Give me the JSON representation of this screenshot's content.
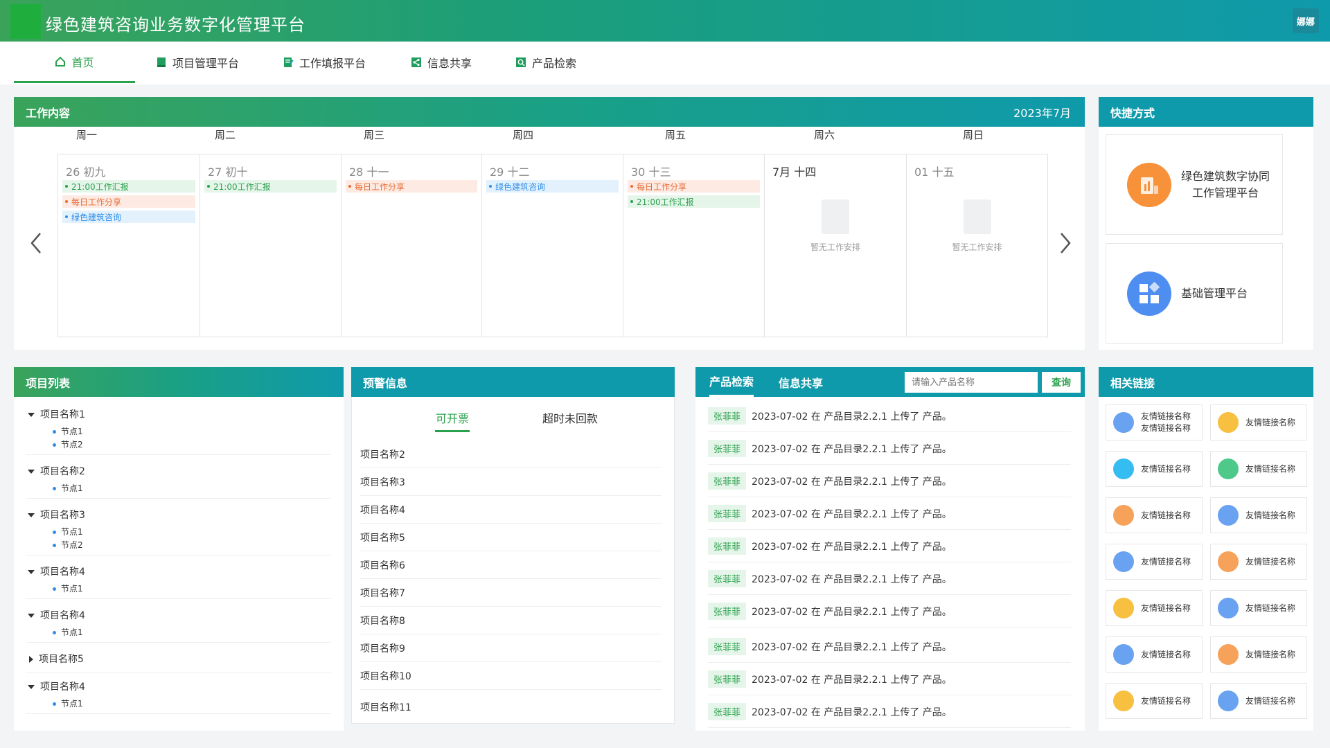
{
  "header": {
    "title": "绿色建筑咨询业务数字化管理平台",
    "user": "娜娜"
  },
  "nav": [
    {
      "label": "首页",
      "icon": "home-icon"
    },
    {
      "label": "项目管理平台",
      "icon": "folder-icon"
    },
    {
      "label": "工作填报平台",
      "icon": "edit-document-icon"
    },
    {
      "label": "信息共享",
      "icon": "share-icon"
    },
    {
      "label": "产品检索",
      "icon": "search-icon"
    }
  ],
  "work": {
    "title": "工作内容",
    "month": "2023年7月",
    "weekdays": [
      "周一",
      "周二",
      "周三",
      "周四",
      "周五",
      "周六",
      "周日"
    ],
    "days": [
      {
        "label": "26 初九",
        "events": [
          {
            "text": "21:00工作汇报",
            "type": "g"
          },
          {
            "text": "每日工作分享",
            "type": "o"
          },
          {
            "text": "绿色建筑咨询",
            "type": "b"
          }
        ]
      },
      {
        "label": "27 初十",
        "events": [
          {
            "text": "21:00工作汇报",
            "type": "g"
          }
        ]
      },
      {
        "label": "28 十一",
        "events": [
          {
            "text": "每日工作分享",
            "type": "o"
          }
        ]
      },
      {
        "label": "29 十二",
        "events": [
          {
            "text": "绿色建筑咨询",
            "type": "b"
          }
        ]
      },
      {
        "label": "30 十三",
        "events": [
          {
            "text": "每日工作分享",
            "type": "o"
          },
          {
            "text": "21:00工作汇报",
            "type": "g"
          }
        ]
      },
      {
        "label": "7月 十四",
        "events": [],
        "empty": "暂无工作安排"
      },
      {
        "label": "01 十五",
        "events": [],
        "empty": "暂无工作安排"
      }
    ]
  },
  "shortcuts": {
    "title": "快捷方式",
    "items": [
      {
        "label1": "绿色建筑数字协同",
        "label2": "工作管理平台",
        "color": "#f7913a"
      },
      {
        "label1": "基础管理平台",
        "label2": "",
        "color": "#4d8ef0"
      }
    ]
  },
  "projects": {
    "title": "项目列表",
    "items": [
      {
        "name": "项目名称1",
        "expanded": true,
        "nodes": [
          "节点1",
          "节点2"
        ]
      },
      {
        "name": "项目名称2",
        "expanded": true,
        "nodes": [
          "节点1"
        ]
      },
      {
        "name": "项目名称3",
        "expanded": true,
        "nodes": [
          "节点1",
          "节点2"
        ]
      },
      {
        "name": "项目名称4",
        "expanded": true,
        "nodes": [
          "节点1"
        ]
      },
      {
        "name": "项目名称4",
        "expanded": true,
        "nodes": [
          "节点1"
        ]
      },
      {
        "name": "项目名称5",
        "expanded": false,
        "nodes": []
      },
      {
        "name": "项目名称4",
        "expanded": true,
        "nodes": [
          "节点1"
        ]
      }
    ]
  },
  "warning": {
    "title": "预警信息",
    "tabs": [
      "可开票",
      "超时未回款"
    ],
    "rows": [
      "项目名称2",
      "项目名称3",
      "项目名称4",
      "项目名称5",
      "项目名称6",
      "项目名称7",
      "项目名称8",
      "项目名称9",
      "项目名称10",
      "项目名称11"
    ]
  },
  "products": {
    "tabs": [
      "产品检索",
      "信息共享"
    ],
    "search_placeholder": "请输入产品名称",
    "search_button": "查询",
    "rows": [
      {
        "user": "张菲菲",
        "text": "2023-07-02 在 产品目录2.2.1 上传了 产品。"
      },
      {
        "user": "张菲菲",
        "text": "2023-07-02 在 产品目录2.2.1 上传了 产品。"
      },
      {
        "user": "张菲菲",
        "text": "2023-07-02 在 产品目录2.2.1 上传了 产品。"
      },
      {
        "user": "张菲菲",
        "text": "2023-07-02 在 产品目录2.2.1 上传了 产品。"
      },
      {
        "user": "张菲菲",
        "text": "2023-07-02 在 产品目录2.2.1 上传了 产品。"
      },
      {
        "user": "张菲菲",
        "text": "2023-07-02 在 产品目录2.2.1 上传了 产品。"
      },
      {
        "user": "张菲菲",
        "text": "2023-07-02 在 产品目录2.2.1 上传了 产品。"
      },
      {
        "user": "张菲菲",
        "text": "2023-07-02 在 产品目录2.2.1 上传了 产品。"
      },
      {
        "user": "张菲菲",
        "text": "2023-07-02 在 产品目录2.2.1 上传了 产品。"
      },
      {
        "user": "张菲菲",
        "text": "2023-07-02 在 产品目录2.2.1 上传了 产品。"
      }
    ]
  },
  "links": {
    "title": "相关链接",
    "items": [
      {
        "text": "友情链接名称友情链接名称",
        "color": "#6aa2f2"
      },
      {
        "text": "友情链接名称",
        "color": "#f7c040"
      },
      {
        "text": "友情链接名称",
        "color": "#35bdf2"
      },
      {
        "text": "友情链接名称",
        "color": "#4fc98a"
      },
      {
        "text": "友情链接名称",
        "color": "#f7a25a"
      },
      {
        "text": "友情链接名称",
        "color": "#6aa2f2"
      },
      {
        "text": "友情链接名称",
        "color": "#6aa2f2"
      },
      {
        "text": "友情链接名称",
        "color": "#f7a25a"
      },
      {
        "text": "友情链接名称",
        "color": "#f7c040"
      },
      {
        "text": "友情链接名称",
        "color": "#6aa2f2"
      },
      {
        "text": "友情链接名称",
        "color": "#6aa2f2"
      },
      {
        "text": "友情链接名称",
        "color": "#f7a25a"
      },
      {
        "text": "友情链接名称",
        "color": "#f7c040"
      },
      {
        "text": "友情链接名称",
        "color": "#6aa2f2"
      }
    ]
  }
}
